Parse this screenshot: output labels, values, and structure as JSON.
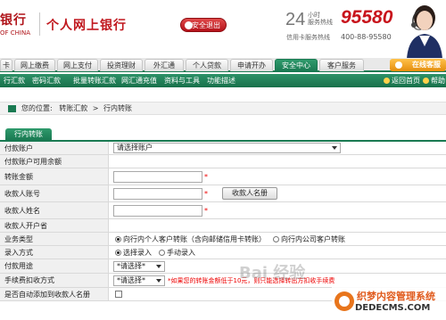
{
  "header": {
    "bank_name": "银行",
    "bank_en": "OF CHINA",
    "site_title": "个人网上银行",
    "logout": "安全退出",
    "hotline_24": "24",
    "hotline_sub1": "小时",
    "hotline_sub2": "服务热线",
    "hotline_number": "95580",
    "cc_label": "信用卡服务热线",
    "cc_number": "400-88-95580"
  },
  "nav": {
    "tabs": [
      {
        "label": "卡"
      },
      {
        "label": "网上缴费"
      },
      {
        "label": "网上支付"
      },
      {
        "label": "投资理财"
      },
      {
        "label": "外汇通"
      },
      {
        "label": "个人贷款"
      },
      {
        "label": "申请开办"
      },
      {
        "label": "安全中心"
      },
      {
        "label": "客户服务"
      }
    ],
    "online_service": "在线客服"
  },
  "subnav": {
    "items": [
      "行汇款",
      "密码汇款",
      "批量转账汇款",
      "网汇通充值",
      "资料与工具",
      "功能描述"
    ],
    "home": "返回首页",
    "help": "帮助"
  },
  "breadcrumb": {
    "prefix": "您的位置:",
    "level1": "转账汇款",
    "sep": ">",
    "level2": "行内转账"
  },
  "section_title": "行内转账",
  "form": {
    "payer_account_label": "付款账户",
    "payer_account_value": "请选择账户",
    "payer_balance_label": "付款账户可用余额",
    "amount_label": "转账金额",
    "payee_account_label": "收款人账号",
    "payee_list_button": "收款人名册",
    "payee_name_label": "收款人姓名",
    "payee_bank_label": "收款人开户省",
    "biz_type_label": "业务类型",
    "biz_type_opt1": "向行内个人客户转账（含向邮储信用卡转账）",
    "biz_type_opt2": "向行内公司客户转账",
    "entry_label": "录入方式",
    "entry_opt1": "选择录入",
    "entry_opt2": "手动录入",
    "purpose_label": "付款用途",
    "purpose_value": "*请选择*",
    "fee_label": "手续费扣收方式",
    "fee_value": "*请选择*",
    "fee_note": "*如果您的转账金额低于10元，则只能选择转出方扣收手续费",
    "add_payee_label": "是否自动添加到收款人名册",
    "required_mark": "*"
  },
  "watermark": {
    "baidu": "Bai 经验",
    "site1": "织梦内容管理系统",
    "site2": "DEDECMS.COM"
  }
}
